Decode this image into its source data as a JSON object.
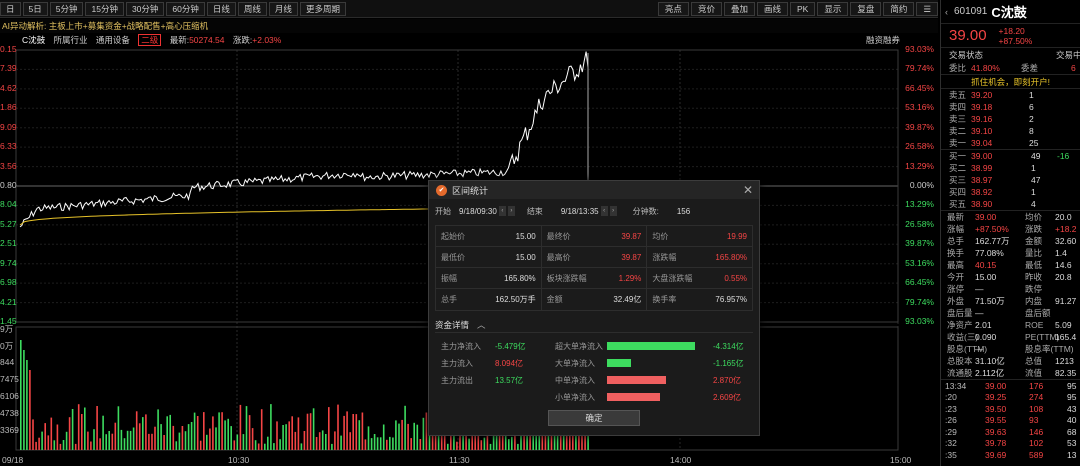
{
  "toolbar": {
    "left_tabs": [
      "日",
      "5日",
      "5分钟",
      "15分钟",
      "30分钟",
      "60分钟",
      "日线",
      "周线",
      "月线",
      "更多周期"
    ],
    "right_buttons": [
      "亮点",
      "竞价",
      "叠加",
      "画线",
      "PK",
      "显示",
      "复盘",
      "简约"
    ]
  },
  "ai_bar": "AI异动解析: 主板上市+募集资金+战略配售+高心压缩机",
  "info_bar": {
    "name": "C沈鼓",
    "industry": "所属行业",
    "sector": "通用设备",
    "badge": "二级",
    "latest_label": "最新:",
    "latest": "50274.54",
    "change_label": "涨跌:",
    "change": "+2.03%",
    "margin": "融资融券"
  },
  "chart": {
    "left_ticks": [
      "0.15",
      "7.39",
      "4.62",
      "1.86",
      "9.09",
      "6.33",
      "3.56",
      "0.80",
      "8.04",
      "5.27",
      "2.51",
      "9.74",
      "6.98",
      "4.21",
      "1.45"
    ],
    "right_ticks": [
      "93.03%",
      "79.74%",
      "66.45%",
      "53.16%",
      "39.87%",
      "26.58%",
      "13.29%",
      "0.00%",
      "13.29%",
      "26.58%",
      "39.87%",
      "53.16%",
      "66.45%",
      "79.74%",
      "93.03%"
    ],
    "vol_ticks": [
      "9万",
      "0万",
      "844",
      "7475",
      "6106",
      "4738",
      "3369"
    ],
    "x_ticks": [
      "09/18",
      "10:30",
      "11:30",
      "14:00",
      "15:00"
    ]
  },
  "dialog": {
    "title": "区间统计",
    "start_label": "开始",
    "start": "9/18/09:30",
    "end_label": "结束",
    "end": "9/18/13:35",
    "minutes_label": "分钟数:",
    "minutes": "156",
    "stats": [
      [
        {
          "k": "起始价",
          "v": "15.00",
          "c": ""
        },
        {
          "k": "最终价",
          "v": "39.87",
          "c": "red"
        },
        {
          "k": "均价",
          "v": "19.99",
          "c": "red"
        }
      ],
      [
        {
          "k": "最低价",
          "v": "15.00",
          "c": ""
        },
        {
          "k": "最高价",
          "v": "39.87",
          "c": "red"
        },
        {
          "k": "涨跌幅",
          "v": "165.80%",
          "c": "red"
        }
      ],
      [
        {
          "k": "振幅",
          "v": "165.80%",
          "c": ""
        },
        {
          "k": "板块涨跌幅",
          "v": "1.29%",
          "c": "red"
        },
        {
          "k": "大盘涨跌幅",
          "v": "0.55%",
          "c": "red"
        }
      ],
      [
        {
          "k": "总手",
          "v": "162.50万手",
          "c": ""
        },
        {
          "k": "金额",
          "v": "32.49亿",
          "c": ""
        },
        {
          "k": "换手率",
          "v": "76.957%",
          "c": ""
        }
      ]
    ],
    "flow_title": "资金详情",
    "left_flow": [
      {
        "k": "主力净流入",
        "v": "-5.479亿",
        "c": "green"
      },
      {
        "k": "主力流入",
        "v": "8.094亿",
        "c": "red"
      },
      {
        "k": "主力流出",
        "v": "13.57亿",
        "c": "green"
      }
    ],
    "right_flow": [
      {
        "k": "超大单净流入",
        "v": "-4.314亿",
        "c": "green",
        "color": "#3ddc5f",
        "frac": 1.0
      },
      {
        "k": "大单净流入",
        "v": "-1.165亿",
        "c": "green",
        "color": "#3ddc5f",
        "frac": 0.27
      },
      {
        "k": "中单净流入",
        "v": "2.870亿",
        "c": "red",
        "color": "#f06060",
        "frac": 0.67
      },
      {
        "k": "小单净流入",
        "v": "2.609亿",
        "c": "red",
        "color": "#f06060",
        "frac": 0.6
      }
    ],
    "ok": "确定"
  },
  "right_panel": {
    "code": "601091",
    "name": "C沈鼓",
    "price": "39.00",
    "chg": "+18.20",
    "pct": "+87.50%",
    "tabs": [
      "交易状态",
      "交易中"
    ],
    "weibi": {
      "k": "委比",
      "v": "41.80%",
      "k2": "委差",
      "v2": "6"
    },
    "ad": "抓住机会，即刻开户!",
    "asks": [
      {
        "k": "卖五",
        "p": "39.20",
        "q": "1"
      },
      {
        "k": "卖四",
        "p": "39.18",
        "q": "6"
      },
      {
        "k": "卖三",
        "p": "39.16",
        "q": "2"
      },
      {
        "k": "卖二",
        "p": "39.10",
        "q": "8"
      },
      {
        "k": "卖一",
        "p": "39.04",
        "q": "25"
      }
    ],
    "bids": [
      {
        "k": "买一",
        "p": "39.00",
        "q": "49",
        "x": "-16"
      },
      {
        "k": "买二",
        "p": "38.99",
        "q": "1",
        "x": ""
      },
      {
        "k": "买三",
        "p": "38.97",
        "q": "47",
        "x": ""
      },
      {
        "k": "买四",
        "p": "38.92",
        "q": "1",
        "x": ""
      },
      {
        "k": "买五",
        "p": "38.90",
        "q": "4",
        "x": ""
      }
    ],
    "quotes": [
      {
        "a": "最新",
        "b": "39.00",
        "c": "均价",
        "d": "20.0"
      },
      {
        "a": "涨幅",
        "b": "+87.50%",
        "c": "涨跌",
        "d": "+18.2"
      },
      {
        "a": "总手",
        "b": "162.77万",
        "c": "金额",
        "d": "32.60"
      },
      {
        "a": "换手",
        "b": "77.08%",
        "c": "量比",
        "d": "1.4"
      },
      {
        "a": "最高",
        "b": "40.15",
        "c": "最低",
        "d": "14.6"
      },
      {
        "a": "今开",
        "b": "15.00",
        "c": "昨收",
        "d": "20.8"
      },
      {
        "a": "涨停",
        "b": "—",
        "c": "跌停",
        "d": ""
      },
      {
        "a": "外盘",
        "b": "71.50万",
        "c": "内盘",
        "d": "91.27"
      },
      {
        "a": "盘后量",
        "b": "—",
        "c": "盘后额",
        "d": ""
      },
      {
        "a": "净资产",
        "b": "2.01",
        "c": "ROE",
        "d": "5.09"
      },
      {
        "a": "收益(三)",
        "b": "0.090",
        "c": "PE(TTM)",
        "d": "165.4"
      },
      {
        "a": "股息(TTM)",
        "b": "—",
        "c": "股息率(TTM)",
        "d": ""
      },
      {
        "a": "总股本",
        "b": "31.10亿",
        "c": "总值",
        "d": "1213"
      },
      {
        "a": "流通股",
        "b": "2.112亿",
        "c": "流值",
        "d": "82.35"
      }
    ],
    "ticks": [
      {
        "t": "13:34",
        "p": "39.00",
        "v": "176",
        "x": "95"
      },
      {
        "t": ":20",
        "p": "39.25",
        "v": "274",
        "x": "95"
      },
      {
        "t": ":23",
        "p": "39.50",
        "v": "108",
        "x": "43"
      },
      {
        "t": ":26",
        "p": "39.55",
        "v": "93",
        "x": "40"
      },
      {
        "t": ":29",
        "p": "39.63",
        "v": "146",
        "x": "68"
      },
      {
        "t": ":32",
        "p": "39.78",
        "v": "102",
        "x": "53"
      },
      {
        "t": ":35",
        "p": "39.69",
        "v": "589",
        "x": "13"
      }
    ]
  },
  "colors": {
    "up": "#f54545",
    "down": "#3ddc5f",
    "price_line": "#ffffff",
    "avg_line": "#e6c229"
  }
}
